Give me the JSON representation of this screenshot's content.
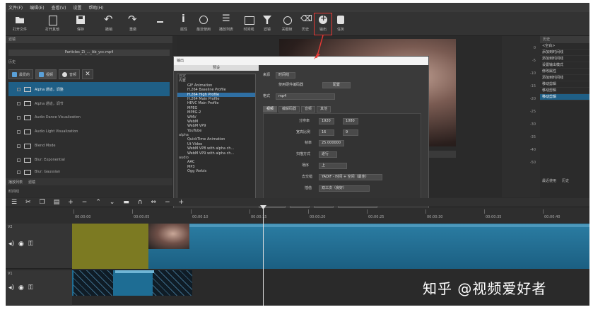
{
  "menu": [
    "文件(F)",
    "编辑(E)",
    "查看(V)",
    "设置",
    "帮助(H)"
  ],
  "toolbar": {
    "items": [
      {
        "label": "打开文件",
        "icon": "open-folder-icon"
      },
      {
        "label": "打开其他",
        "icon": "open-other-icon"
      },
      {
        "label": "保存",
        "icon": "save-icon"
      },
      {
        "label": "撤销",
        "icon": "undo-icon"
      },
      {
        "label": "重做",
        "icon": "redo-icon"
      },
      {
        "label": "",
        "icon": "fullscreen-icon"
      },
      {
        "label": "属性",
        "icon": "info-icon"
      },
      {
        "label": "最近使用",
        "icon": "recent-icon"
      },
      {
        "label": "播放列表",
        "icon": "playlist-icon"
      },
      {
        "label": "时间线",
        "icon": "timeline-icon"
      },
      {
        "label": "滤镜",
        "icon": "filter-icon"
      },
      {
        "label": "关键帧",
        "icon": "keyframe-icon"
      },
      {
        "label": "历史",
        "icon": "history-icon"
      },
      {
        "label": "输出",
        "icon": "export-icon",
        "highlight": true
      },
      {
        "label": "任务",
        "icon": "jobs-icon"
      }
    ]
  },
  "left": {
    "header": "滤镜",
    "filename": "Particles_Zi_..._Ab_ycc.mp4",
    "history_label": "历史",
    "tabs": [
      {
        "label": "最爱的"
      },
      {
        "label": "视频"
      },
      {
        "label": "音频"
      }
    ],
    "filters": [
      "Alpha 通道，调整",
      "Alpha 通道，调节",
      "Audio Dance Visualization",
      "Audio Light Visualization",
      "Blend Mode",
      "Blur: Exponential",
      "Blur: Gaussian"
    ],
    "bottom_tabs": [
      "播放列表",
      "滤镜"
    ],
    "timeline_label": "时间线"
  },
  "dialog": {
    "title": "输出",
    "subtitle": "预设",
    "presets": [
      {
        "text": "自定",
        "kind": "hdr"
      },
      {
        "text": "内置",
        "kind": "grp"
      },
      {
        "text": "GIF Animation"
      },
      {
        "text": "H.264 Baseline Profile"
      },
      {
        "text": "H.264 High Profile",
        "selected": true
      },
      {
        "text": "H.264 Main Profile"
      },
      {
        "text": "HEVC Main Profile"
      },
      {
        "text": "MPEG"
      },
      {
        "text": "MPEG-2"
      },
      {
        "text": "WMV"
      },
      {
        "text": "WebM"
      },
      {
        "text": "WebM VP9"
      },
      {
        "text": "YouTube"
      },
      {
        "text": "alpha",
        "kind": "grp"
      },
      {
        "text": "QuickTime Animation"
      },
      {
        "text": "Ut Video"
      },
      {
        "text": "WebM VP8 with alpha ch..."
      },
      {
        "text": "WebM VP9 with alpha ch..."
      },
      {
        "text": "audio",
        "kind": "grp"
      },
      {
        "text": "AAC"
      },
      {
        "text": "MP3"
      },
      {
        "text": "Ogg Vorbis"
      }
    ],
    "source_label": "来源",
    "source_value": "时间线",
    "hw_label": "使用硬件编码器",
    "config_btn": "配置",
    "format_label": "格式",
    "format_value": "mp4",
    "tabs": [
      "视频",
      "编解码器",
      "音频",
      "其他"
    ],
    "fields": [
      {
        "label": "分辨率",
        "v1": "1920",
        "v2": "1080"
      },
      {
        "label": "宽高比例",
        "v1": "16",
        "v2": "9"
      },
      {
        "label": "帧率",
        "v1": "25.000000"
      },
      {
        "label": "扫描方式",
        "v1": "逐行"
      },
      {
        "label": "场序",
        "v1": "上"
      },
      {
        "label": "去交错",
        "v1": "YADIF - 时间 + 空间（最佳）"
      },
      {
        "label": "插值",
        "v1": "双三次（良好）"
      }
    ],
    "buttons": [
      "输出文件",
      "重置",
      "停止",
      "更多（Stream）"
    ]
  },
  "meter": {
    "ticks": [
      "0",
      "-5",
      "-10",
      "-15",
      "-20",
      "-25",
      "-30",
      "-35",
      "-40",
      "-50"
    ]
  },
  "history": {
    "header": "历史",
    "items": [
      "<空白>",
      "添加到时间线",
      "添加到时间线",
      "设置输出模式",
      "修改属性",
      "添加到时间线",
      "移动剪辑",
      "移动剪辑",
      "移动剪辑"
    ],
    "bottom": [
      "最近使用",
      "历史"
    ]
  },
  "timeline": {
    "ruler": [
      "00:00:00",
      "00:00:05",
      "00:00:10",
      "00:00:15",
      "00:00:20",
      "00:00:25",
      "00:00:30",
      "00:00:35",
      "00:00:40"
    ],
    "tracks": [
      {
        "name": "V2"
      },
      {
        "name": "V1"
      }
    ]
  },
  "watermark": "知乎 @视频爱好者",
  "colors": {
    "highlight": "#e53935",
    "selection": "#1f5f86",
    "clip_olive": "#7c7a22",
    "clip_blue": "#1e6d94"
  }
}
